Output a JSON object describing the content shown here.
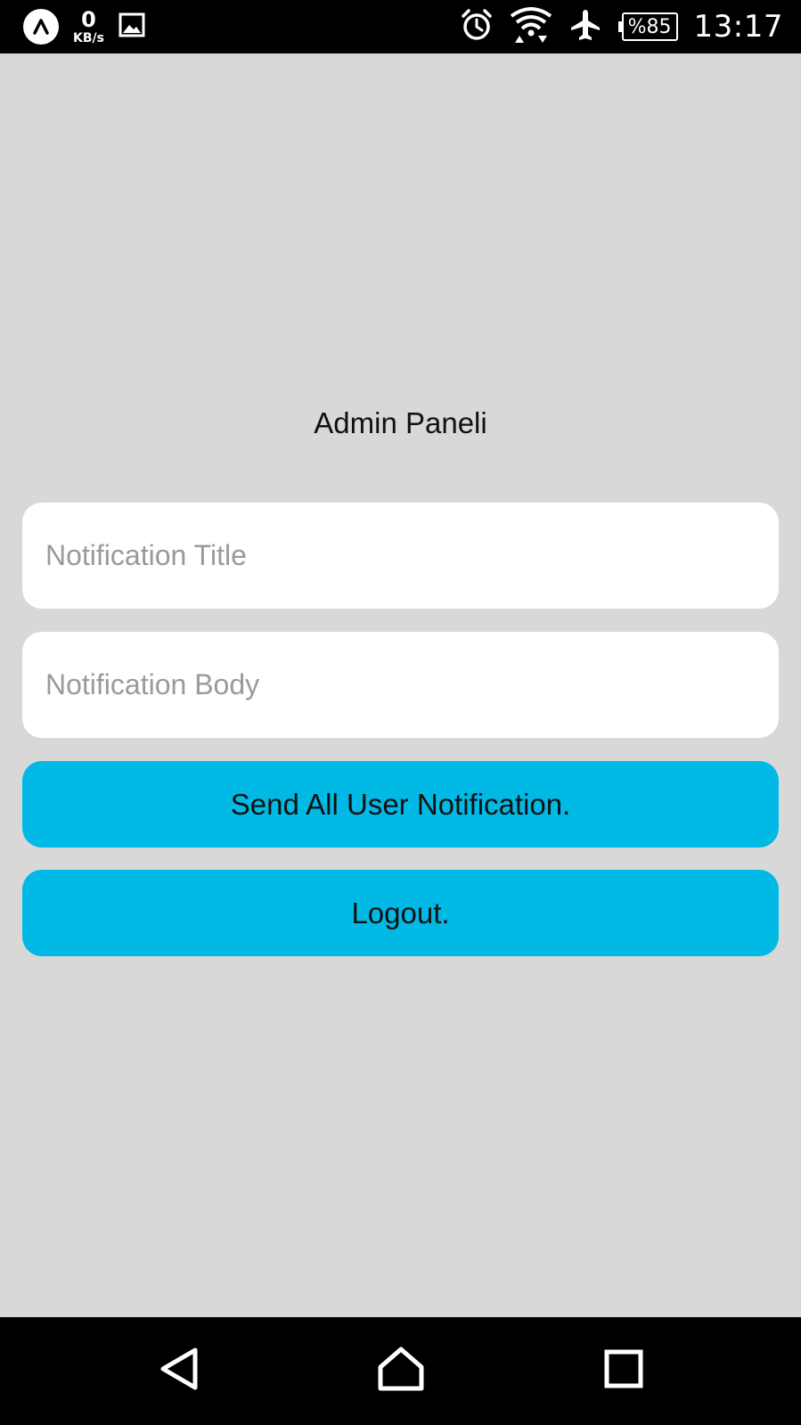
{
  "status_bar": {
    "net_speed_value": "0",
    "net_speed_unit": "KB/s",
    "battery": "%85",
    "time": "13:17",
    "icons": [
      "app-logo-icon",
      "image-notification-icon",
      "alarm-icon",
      "wifi-icon",
      "airplane-icon",
      "battery-icon"
    ]
  },
  "main": {
    "title": "Admin Paneli",
    "notification_title_placeholder": "Notification Title",
    "notification_body_placeholder": "Notification Body",
    "send_button_label": "Send All User Notification.",
    "logout_button_label": "Logout."
  },
  "nav_bar": {
    "icons": [
      "back-icon",
      "home-icon",
      "recents-icon"
    ]
  },
  "colors": {
    "background": "#d8d8d8",
    "button": "#00b9e4",
    "field": "#ffffff",
    "placeholder": "#9a9a9a"
  }
}
